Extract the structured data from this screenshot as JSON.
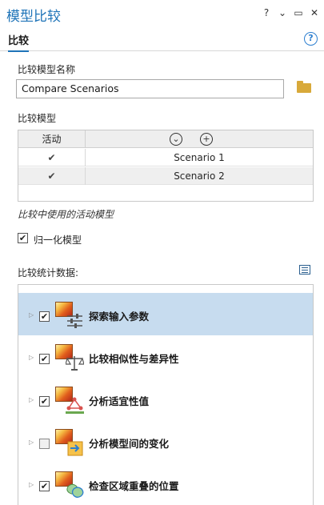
{
  "window": {
    "title": "模型比较",
    "controls": [
      "?",
      "⌄",
      "▭",
      "✕"
    ]
  },
  "tab": {
    "label": "比较",
    "help": "?"
  },
  "name_section": {
    "label": "比较模型名称",
    "value": "Compare Scenarios"
  },
  "models_section": {
    "label": "比较模型",
    "header_active": "活动",
    "header_down_icon": "⌄",
    "header_add_icon": "+",
    "rows": [
      {
        "checked": "✔",
        "name": "Scenario 1"
      },
      {
        "checked": "✔",
        "name": "Scenario 2"
      }
    ]
  },
  "note": "比较中使用的活动模型",
  "normalize": {
    "checked": "✔",
    "label": "归一化模型"
  },
  "stats_section": {
    "label": "比较统计数据:",
    "items": [
      {
        "label": "探索输入参数",
        "checked": "✔",
        "icon": "sliders-icon"
      },
      {
        "label": "比较相似性与差异性",
        "checked": "✔",
        "icon": "scale-icon"
      },
      {
        "label": "分析适宜性值",
        "checked": "✔",
        "icon": "network-icon"
      },
      {
        "label": "分析模型间的变化",
        "checked": "",
        "icon": "change-icon"
      },
      {
        "label": "检查区域重叠的位置",
        "checked": "✔",
        "icon": "overlap-icon"
      }
    ]
  },
  "colors": {
    "accent": "#1f74b8",
    "selected_row": "#c7dcef"
  }
}
